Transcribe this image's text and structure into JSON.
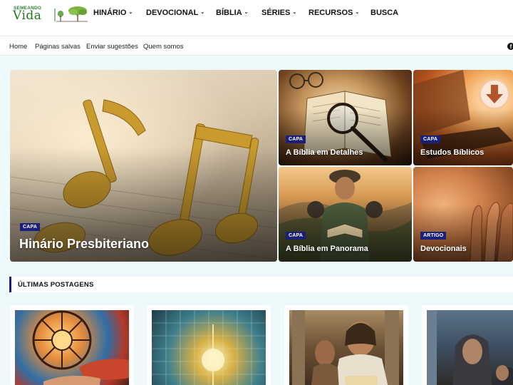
{
  "logo": {
    "top": "SEMEANDO",
    "main": "Vida"
  },
  "nav": {
    "items": [
      {
        "label": "HINÁRIO",
        "has_dropdown": true
      },
      {
        "label": "DEVOCIONAL",
        "has_dropdown": true
      },
      {
        "label": "BÍBLIA",
        "has_dropdown": true
      },
      {
        "label": "SÉRIES",
        "has_dropdown": true
      },
      {
        "label": "RECURSOS",
        "has_dropdown": true
      },
      {
        "label": "BUSCA",
        "has_dropdown": false
      }
    ],
    "chevron": "⌄"
  },
  "subnav": {
    "items": [
      "Home",
      "Páginas salvas",
      "Enviar sugestões",
      "Quem somos"
    ],
    "social_icon": "facebook-icon",
    "social_glyph": "f"
  },
  "featured": [
    {
      "badge": "CAPA",
      "title": "Hinário Presbiteriano",
      "image": "golden-music-notes"
    },
    {
      "badge": "CAPA",
      "title": "A Bíblia em Detalhes",
      "image": "open-bible-magnifier-glasses"
    },
    {
      "badge": "CAPA",
      "title": "Estudos Bíblicos",
      "image": "laptop-download-arrow"
    },
    {
      "badge": "CAPA",
      "title": "A Bíblia em Panorama",
      "image": "traveler-reading-bible-landscape"
    },
    {
      "badge": "ARTIGO",
      "title": "Devocionais",
      "image": "praying-hands"
    }
  ],
  "latest": {
    "title": "ÚLTIMAS POSTAGENS",
    "posts": [
      {
        "image": "stained-glass-hands"
      },
      {
        "image": "calendar-grid-light"
      },
      {
        "image": "bearded-men-scroll-temple"
      },
      {
        "image": "hooded-figures-street"
      }
    ]
  },
  "colors": {
    "badge_bg": "#1a1f7a",
    "page_bg": "#eef9fc",
    "logo_green": "#1e7a1e"
  }
}
